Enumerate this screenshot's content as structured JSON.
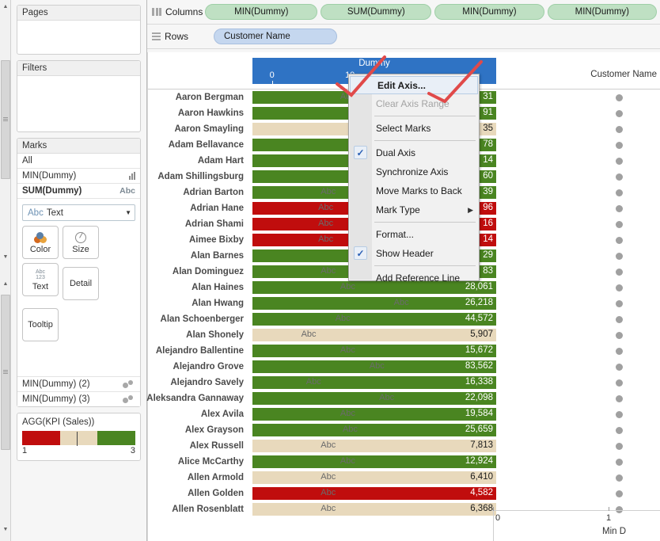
{
  "panels": {
    "pages": {
      "title": "Pages"
    },
    "filters": {
      "title": "Filters"
    },
    "marks": {
      "title": "Marks",
      "all_label": "All",
      "cards": [
        {
          "label": "MIN(Dummy)",
          "glyph": "bar-chart-icon",
          "selected": false
        },
        {
          "label": "SUM(Dummy)",
          "glyph": "abc-icon",
          "selected": true
        }
      ],
      "mark_type": "Text",
      "mark_type_prefix": "Abc",
      "shelf_buttons": [
        {
          "label": "Color",
          "icon": "color-circles-icon"
        },
        {
          "label": "Size",
          "icon": "size-circle-icon"
        },
        {
          "label": "Text",
          "icon": "abc-123-icon"
        },
        {
          "label": "Detail",
          "icon": "detail-icon"
        },
        {
          "label": "Tooltip",
          "icon": "tooltip-icon"
        }
      ],
      "stacked_cards": [
        {
          "label": "MIN(Dummy) (2)",
          "glyph": "circles-icon"
        },
        {
          "label": "MIN(Dummy) (3)",
          "glyph": "circles-icon"
        }
      ]
    },
    "legend": {
      "title": "AGG(KPI (Sales))",
      "min": "1",
      "max": "3",
      "colors": [
        "#c00d0d",
        "#e8d9bc",
        "#4a8521"
      ]
    }
  },
  "shelves": {
    "columns": {
      "label": "Columns",
      "icon": "columns-icon",
      "pills": [
        "MIN(Dummy)",
        "SUM(Dummy)",
        "MIN(Dummy)",
        "MIN(Dummy)"
      ]
    },
    "rows": {
      "label": "Rows",
      "icon": "rows-icon",
      "pills": [
        "Customer Name"
      ]
    }
  },
  "viz": {
    "axis_title": "Dummy",
    "axis_ticks": [
      "0",
      "10"
    ],
    "row_header_label": "Customer Name",
    "abc_text": "Abc",
    "bottom_axis": {
      "ticks": [
        "0",
        "1"
      ],
      "title": "Min D"
    }
  },
  "context_menu": {
    "items": [
      {
        "label": "Edit Axis...",
        "checked": false,
        "disabled": false,
        "submenu": false,
        "bold": true
      },
      {
        "label": "Clear Axis Range",
        "checked": false,
        "disabled": true,
        "submenu": false,
        "bold": false
      },
      {
        "separator": true
      },
      {
        "label": "Select Marks",
        "checked": false,
        "disabled": false,
        "submenu": false,
        "bold": false
      },
      {
        "separator": true
      },
      {
        "label": "Dual Axis",
        "checked": true,
        "disabled": false,
        "submenu": false,
        "bold": false
      },
      {
        "label": "Synchronize Axis",
        "checked": false,
        "disabled": false,
        "submenu": false,
        "bold": false
      },
      {
        "label": "Move Marks to Back",
        "checked": false,
        "disabled": false,
        "submenu": false,
        "bold": false
      },
      {
        "label": "Mark Type",
        "checked": false,
        "disabled": false,
        "submenu": true,
        "bold": false
      },
      {
        "separator": true
      },
      {
        "label": "Format...",
        "checked": false,
        "disabled": false,
        "submenu": false,
        "bold": false
      },
      {
        "label": "Show Header",
        "checked": true,
        "disabled": false,
        "submenu": false,
        "bold": false
      },
      {
        "separator": true
      },
      {
        "label": "Add Reference Line",
        "checked": false,
        "disabled": false,
        "submenu": false,
        "bold": false
      }
    ],
    "check_glyph": "✓",
    "submenu_glyph": "▶"
  },
  "chart_data": {
    "type": "bar",
    "title": "Dummy",
    "xlabel": "",
    "ylabel": "Customer Name",
    "xlim": [
      0,
      20
    ],
    "grid": false,
    "legend": "AGG(KPI (Sales))",
    "categories": [
      "Aaron Bergman",
      "Aaron Hawkins",
      "Aaron Smayling",
      "Adam Bellavance",
      "Adam Hart",
      "Adam Shillingsburg",
      "Adrian Barton",
      "Adrian Hane",
      "Adrian Shami",
      "Aimee Bixby",
      "Alan Barnes",
      "Alan Dominguez",
      "Alan Haines",
      "Alan Hwang",
      "Alan Schoenberger",
      "Alan Shonely",
      "Alejandro Ballentine",
      "Alejandro Grove",
      "Alejandro Savely",
      "Aleksandra Gannaway",
      "Alex Avila",
      "Alex Grayson",
      "Alex Russell",
      "Alice McCarthy",
      "Allen Armold",
      "Allen Golden",
      "Allen Rosenblatt"
    ],
    "values": [
      null,
      null,
      null,
      null,
      null,
      null,
      null,
      null,
      null,
      null,
      null,
      null,
      28061,
      26218,
      44572,
      5907,
      15672,
      83562,
      16338,
      22098,
      19584,
      25659,
      7813,
      12924,
      6410,
      4582,
      6368
    ],
    "value_labels": [
      "31",
      "91",
      "35",
      "78",
      "14",
      "60",
      "39",
      "96",
      "16",
      "14",
      "29",
      "83",
      "28,061",
      "26,218",
      "44,572",
      "5,907",
      "15,672",
      "83,562",
      "16,338",
      "22,098",
      "19,584",
      "25,659",
      "7,813",
      "12,924",
      "6,410",
      "4,582",
      "6,368"
    ],
    "kpi_colors": [
      "green",
      "green",
      "tan",
      "green",
      "green",
      "green",
      "green",
      "red",
      "red",
      "red",
      "green",
      "green",
      "green",
      "green",
      "green",
      "tan",
      "green",
      "green",
      "green",
      "green",
      "green",
      "green",
      "tan",
      "green",
      "tan",
      "red",
      "tan"
    ],
    "abc_positions_pct": [
      36,
      57,
      78,
      56,
      null,
      57,
      28,
      27,
      27,
      27,
      72,
      28,
      36,
      58,
      34,
      20,
      36,
      48,
      22,
      52,
      36,
      37,
      28,
      36,
      28,
      28,
      28
    ],
    "color_map": {
      "green": "#4a8521",
      "red": "#c00d0d",
      "tan": "#e8d9bc"
    },
    "dot_series_name": "Min D",
    "dot_count": 27
  }
}
